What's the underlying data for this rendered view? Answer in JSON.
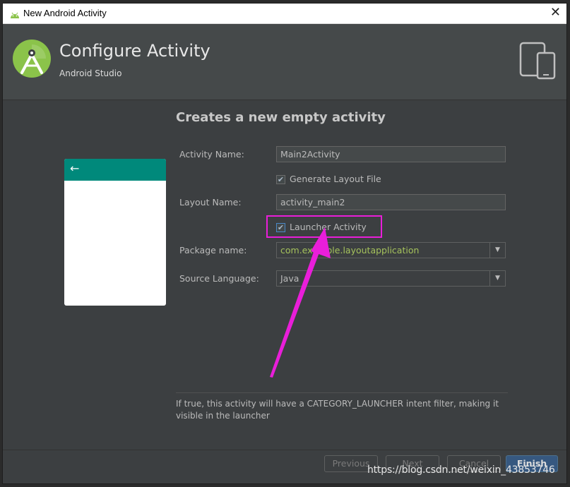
{
  "window": {
    "title": "New Android Activity",
    "close_glyph": "✕"
  },
  "header": {
    "title": "Configure Activity",
    "subtitle": "Android Studio",
    "logo_icon": "android-studio-logo",
    "device_icon": "tablet-phone-icon"
  },
  "form": {
    "section_title": "Creates a new empty activity",
    "activity_name_label": "Activity Name:",
    "activity_name_value": "Main2Activity",
    "generate_layout_label": "Generate Layout File",
    "generate_layout_checked": true,
    "layout_name_label": "Layout Name:",
    "layout_name_value": "activity_main2",
    "launcher_activity_label": "Launcher Activity",
    "launcher_activity_checked": true,
    "package_name_label": "Package name:",
    "package_name_value": "com.example.layoutapplication",
    "source_language_label": "Source Language:",
    "source_language_value": "Java"
  },
  "preview": {
    "back_glyph": "←",
    "toolbar_color": "#00897b"
  },
  "help_text": "If true, this activity will have a CATEGORY_LAUNCHER intent filter, making it visible in the launcher",
  "buttons": {
    "previous": "Previous",
    "next": "Next",
    "cancel": "Cancel",
    "finish": "Finish"
  },
  "watermark": "https://blog.csdn.net/weixin_43853746",
  "colors": {
    "accent": "#365880",
    "annotation": "#e91ed9",
    "package_text": "#a5c25c"
  }
}
